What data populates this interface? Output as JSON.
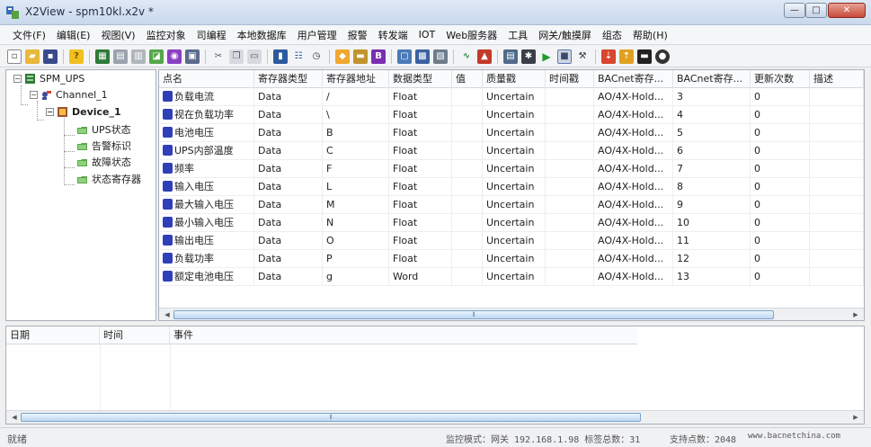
{
  "window": {
    "title": "X2View - spm10kl.x2v *",
    "minimize_glyph": "—",
    "maximize_glyph": "□",
    "close_glyph": "✕"
  },
  "menu": [
    "文件(F)",
    "编辑(E)",
    "视图(V)",
    "监控对象",
    "司编程",
    "本地数据库",
    "用户管理",
    "报警",
    "转发端",
    "IOT",
    "Web服务器",
    "工具",
    "网关/触摸屏",
    "组态",
    "帮助(H)"
  ],
  "toolbar": {
    "icons": [
      "new-icon",
      "open-icon",
      "save-icon",
      "help-icon",
      "channel-icon",
      "device-icon",
      "copy-device-icon",
      "point-icon",
      "color-icon",
      "property-icon",
      "cut-icon",
      "copy-icon",
      "paste-icon",
      "view-icon",
      "grid-icon",
      "clock-icon",
      "tag-icon",
      "database-icon",
      "bold-icon",
      "monitor-icon",
      "screen-icon",
      "export-icon",
      "link-icon",
      "lock-icon",
      "compile-icon",
      "settings-icon",
      "run-icon",
      "stop-icon",
      "tools-icon",
      "download-icon",
      "upload-icon",
      "display-icon",
      "network-icon"
    ]
  },
  "tree": {
    "root": "SPM_UPS",
    "channel": "Channel_1",
    "device": "Device_1",
    "groups": [
      "UPS状态",
      "告警标识",
      "故障状态",
      "状态寄存器"
    ]
  },
  "grid": {
    "columns": [
      "点名",
      "寄存器类型",
      "寄存器地址",
      "数据类型",
      "值",
      "质量戳",
      "时间戳",
      "BACnet寄存...",
      "BACnet寄存...",
      "更新次数",
      "描述"
    ],
    "rows": [
      [
        "负载电流",
        "Data",
        "/",
        "Float",
        "",
        "Uncertain",
        "",
        "AO/4X-Hold...",
        "3",
        "0",
        ""
      ],
      [
        "视在负载功率",
        "Data",
        "\\",
        "Float",
        "",
        "Uncertain",
        "",
        "AO/4X-Hold...",
        "4",
        "0",
        ""
      ],
      [
        "电池电压",
        "Data",
        "B",
        "Float",
        "",
        "Uncertain",
        "",
        "AO/4X-Hold...",
        "5",
        "0",
        ""
      ],
      [
        "UPS内部温度",
        "Data",
        "C",
        "Float",
        "",
        "Uncertain",
        "",
        "AO/4X-Hold...",
        "6",
        "0",
        ""
      ],
      [
        "频率",
        "Data",
        "F",
        "Float",
        "",
        "Uncertain",
        "",
        "AO/4X-Hold...",
        "7",
        "0",
        ""
      ],
      [
        "输入电压",
        "Data",
        "L",
        "Float",
        "",
        "Uncertain",
        "",
        "AO/4X-Hold...",
        "8",
        "0",
        ""
      ],
      [
        "最大输入电压",
        "Data",
        "M",
        "Float",
        "",
        "Uncertain",
        "",
        "AO/4X-Hold...",
        "9",
        "0",
        ""
      ],
      [
        "最小输入电压",
        "Data",
        "N",
        "Float",
        "",
        "Uncertain",
        "",
        "AO/4X-Hold...",
        "10",
        "0",
        ""
      ],
      [
        "输出电压",
        "Data",
        "O",
        "Float",
        "",
        "Uncertain",
        "",
        "AO/4X-Hold...",
        "11",
        "0",
        ""
      ],
      [
        "负载功率",
        "Data",
        "P",
        "Float",
        "",
        "Uncertain",
        "",
        "AO/4X-Hold...",
        "12",
        "0",
        ""
      ],
      [
        "额定电池电压",
        "Data",
        "g",
        "Word",
        "",
        "Uncertain",
        "",
        "AO/4X-Hold...",
        "13",
        "0",
        ""
      ]
    ]
  },
  "log": {
    "columns": [
      "日期",
      "时间",
      "事件"
    ]
  },
  "status": {
    "ready": "就绪",
    "monitor_mode": "监控模式：网关 192.168.1.98 标签总数：31",
    "supported_points": "支持点数：2048",
    "website": "www.bacnetchina.com"
  },
  "colors": {
    "title_gradient_top": "#dfe9f5",
    "point_icon": "#2f3fb8",
    "scroll_thumb": "#bfd8f1"
  }
}
